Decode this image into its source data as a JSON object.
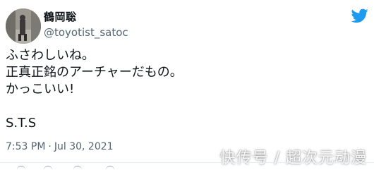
{
  "user": {
    "display_name": "鶴岡聡",
    "handle": "@toyotist_satoc"
  },
  "tweet": {
    "lines": [
      "ふさわしいね。",
      "正真正銘のアーチャーだもの。",
      "かっこいい!",
      "",
      "S.T.S"
    ]
  },
  "meta": {
    "time": "7:53 PM",
    "separator": "·",
    "date": "Jul 30, 2021"
  },
  "watermark": {
    "text": "快传号 / 超次元动漫"
  },
  "colors": {
    "twitter_blue": "#1d9bf0",
    "text_primary": "#0f1419",
    "text_secondary": "#536471"
  },
  "icons": {
    "brand": "twitter-bird-icon"
  }
}
